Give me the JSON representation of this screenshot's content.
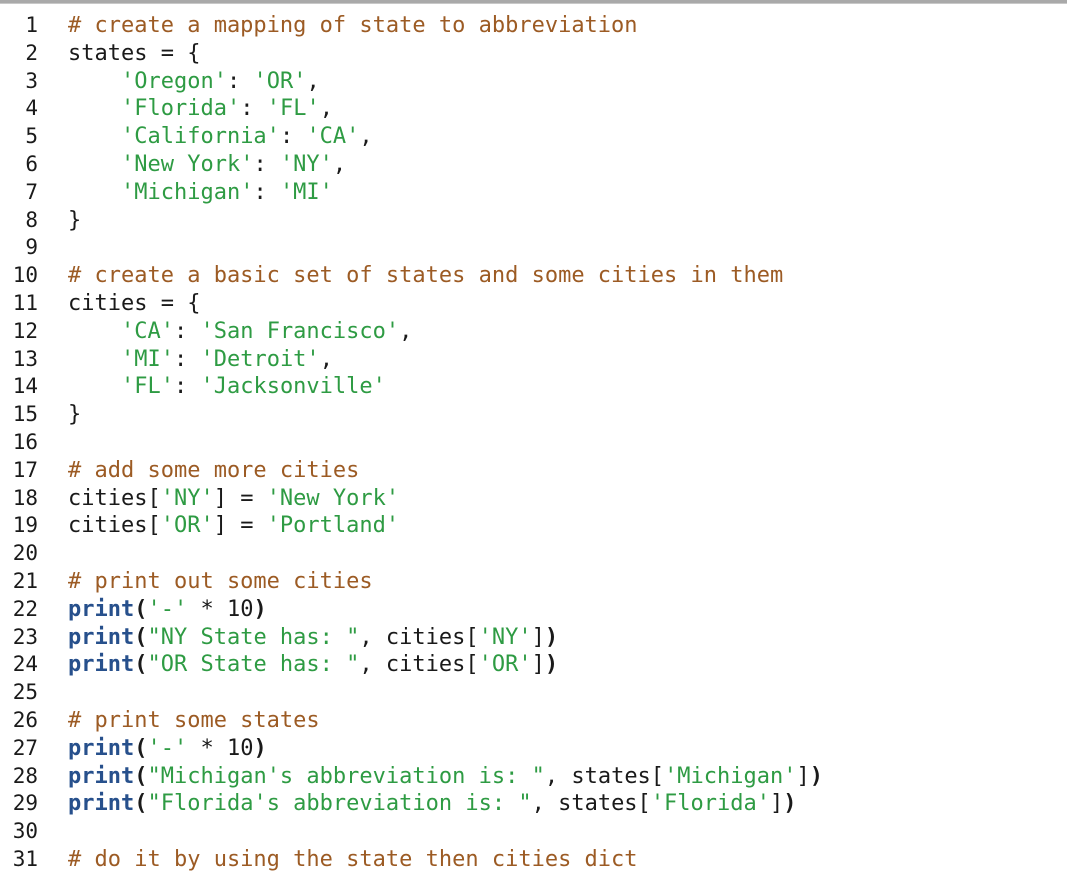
{
  "document": {
    "kind": "python-code-listing",
    "language": "Python",
    "first_line_number": 1,
    "last_line_number": 31,
    "total_lines_visible": 31
  },
  "theme": {
    "background": "#ffffff",
    "top_rule": "#a9a9a9",
    "line_number_color": "#1a1a1a",
    "comment_color": "#9c5b24",
    "string_color": "#2e9b43",
    "keyword_color": "#27508c",
    "punctuation_color": "#1a1a1a",
    "plain_color": "#1a1a1a"
  },
  "lines": [
    {
      "num": "1",
      "tokens": [
        {
          "t": "comment",
          "s": "# create a mapping of state to abbreviation"
        }
      ]
    },
    {
      "num": "2",
      "tokens": [
        {
          "t": "plain",
          "s": "states = {"
        }
      ]
    },
    {
      "num": "3",
      "tokens": [
        {
          "t": "plain",
          "s": "    "
        },
        {
          "t": "string",
          "s": "'Oregon'"
        },
        {
          "t": "plain",
          "s": ": "
        },
        {
          "t": "string",
          "s": "'OR'"
        },
        {
          "t": "plain",
          "s": ","
        }
      ]
    },
    {
      "num": "4",
      "tokens": [
        {
          "t": "plain",
          "s": "    "
        },
        {
          "t": "string",
          "s": "'Florida'"
        },
        {
          "t": "plain",
          "s": ": "
        },
        {
          "t": "string",
          "s": "'FL'"
        },
        {
          "t": "plain",
          "s": ","
        }
      ]
    },
    {
      "num": "5",
      "tokens": [
        {
          "t": "plain",
          "s": "    "
        },
        {
          "t": "string",
          "s": "'California'"
        },
        {
          "t": "plain",
          "s": ": "
        },
        {
          "t": "string",
          "s": "'CA'"
        },
        {
          "t": "plain",
          "s": ","
        }
      ]
    },
    {
      "num": "6",
      "tokens": [
        {
          "t": "plain",
          "s": "    "
        },
        {
          "t": "string",
          "s": "'New York'"
        },
        {
          "t": "plain",
          "s": ": "
        },
        {
          "t": "string",
          "s": "'NY'"
        },
        {
          "t": "plain",
          "s": ","
        }
      ]
    },
    {
      "num": "7",
      "tokens": [
        {
          "t": "plain",
          "s": "    "
        },
        {
          "t": "string",
          "s": "'Michigan'"
        },
        {
          "t": "plain",
          "s": ": "
        },
        {
          "t": "string",
          "s": "'MI'"
        }
      ]
    },
    {
      "num": "8",
      "tokens": [
        {
          "t": "plain",
          "s": "}"
        }
      ]
    },
    {
      "num": "9",
      "tokens": []
    },
    {
      "num": "10",
      "tokens": [
        {
          "t": "comment",
          "s": "# create a basic set of states and some cities in them"
        }
      ]
    },
    {
      "num": "11",
      "tokens": [
        {
          "t": "plain",
          "s": "cities = {"
        }
      ]
    },
    {
      "num": "12",
      "tokens": [
        {
          "t": "plain",
          "s": "    "
        },
        {
          "t": "string",
          "s": "'CA'"
        },
        {
          "t": "plain",
          "s": ": "
        },
        {
          "t": "string",
          "s": "'San Francisco'"
        },
        {
          "t": "plain",
          "s": ","
        }
      ]
    },
    {
      "num": "13",
      "tokens": [
        {
          "t": "plain",
          "s": "    "
        },
        {
          "t": "string",
          "s": "'MI'"
        },
        {
          "t": "plain",
          "s": ": "
        },
        {
          "t": "string",
          "s": "'Detroit'"
        },
        {
          "t": "plain",
          "s": ","
        }
      ]
    },
    {
      "num": "14",
      "tokens": [
        {
          "t": "plain",
          "s": "    "
        },
        {
          "t": "string",
          "s": "'FL'"
        },
        {
          "t": "plain",
          "s": ": "
        },
        {
          "t": "string",
          "s": "'Jacksonville'"
        }
      ]
    },
    {
      "num": "15",
      "tokens": [
        {
          "t": "plain",
          "s": "}"
        }
      ]
    },
    {
      "num": "16",
      "tokens": []
    },
    {
      "num": "17",
      "tokens": [
        {
          "t": "comment",
          "s": "# add some more cities"
        }
      ]
    },
    {
      "num": "18",
      "tokens": [
        {
          "t": "plain",
          "s": "cities["
        },
        {
          "t": "string",
          "s": "'NY'"
        },
        {
          "t": "plain",
          "s": "] = "
        },
        {
          "t": "string",
          "s": "'New York'"
        }
      ]
    },
    {
      "num": "19",
      "tokens": [
        {
          "t": "plain",
          "s": "cities["
        },
        {
          "t": "string",
          "s": "'OR'"
        },
        {
          "t": "plain",
          "s": "] = "
        },
        {
          "t": "string",
          "s": "'Portland'"
        }
      ]
    },
    {
      "num": "20",
      "tokens": []
    },
    {
      "num": "21",
      "tokens": [
        {
          "t": "comment",
          "s": "# print out some cities"
        }
      ]
    },
    {
      "num": "22",
      "tokens": [
        {
          "t": "keyword",
          "s": "print"
        },
        {
          "t": "punct",
          "s": "("
        },
        {
          "t": "string",
          "s": "'-'"
        },
        {
          "t": "plain",
          "s": " * "
        },
        {
          "t": "number",
          "s": "10"
        },
        {
          "t": "punct",
          "s": ")"
        }
      ]
    },
    {
      "num": "23",
      "tokens": [
        {
          "t": "keyword",
          "s": "print"
        },
        {
          "t": "punct",
          "s": "("
        },
        {
          "t": "string",
          "s": "\"NY State has: \""
        },
        {
          "t": "plain",
          "s": ", cities["
        },
        {
          "t": "string",
          "s": "'NY'"
        },
        {
          "t": "plain",
          "s": "]"
        },
        {
          "t": "punct",
          "s": ")"
        }
      ]
    },
    {
      "num": "24",
      "tokens": [
        {
          "t": "keyword",
          "s": "print"
        },
        {
          "t": "punct",
          "s": "("
        },
        {
          "t": "string",
          "s": "\"OR State has: \""
        },
        {
          "t": "plain",
          "s": ", cities["
        },
        {
          "t": "string",
          "s": "'OR'"
        },
        {
          "t": "plain",
          "s": "]"
        },
        {
          "t": "punct",
          "s": ")"
        }
      ]
    },
    {
      "num": "25",
      "tokens": []
    },
    {
      "num": "26",
      "tokens": [
        {
          "t": "comment",
          "s": "# print some states"
        }
      ]
    },
    {
      "num": "27",
      "tokens": [
        {
          "t": "keyword",
          "s": "print"
        },
        {
          "t": "punct",
          "s": "("
        },
        {
          "t": "string",
          "s": "'-'"
        },
        {
          "t": "plain",
          "s": " * "
        },
        {
          "t": "number",
          "s": "10"
        },
        {
          "t": "punct",
          "s": ")"
        }
      ]
    },
    {
      "num": "28",
      "tokens": [
        {
          "t": "keyword",
          "s": "print"
        },
        {
          "t": "punct",
          "s": "("
        },
        {
          "t": "string",
          "s": "\"Michigan's abbreviation is: \""
        },
        {
          "t": "plain",
          "s": ", states["
        },
        {
          "t": "string",
          "s": "'Michigan'"
        },
        {
          "t": "plain",
          "s": "]"
        },
        {
          "t": "punct",
          "s": ")"
        }
      ]
    },
    {
      "num": "29",
      "tokens": [
        {
          "t": "keyword",
          "s": "print"
        },
        {
          "t": "punct",
          "s": "("
        },
        {
          "t": "string",
          "s": "\"Florida's abbreviation is: \""
        },
        {
          "t": "plain",
          "s": ", states["
        },
        {
          "t": "string",
          "s": "'Florida'"
        },
        {
          "t": "plain",
          "s": "]"
        },
        {
          "t": "punct",
          "s": ")"
        }
      ]
    },
    {
      "num": "30",
      "tokens": []
    },
    {
      "num": "31",
      "tokens": [
        {
          "t": "comment",
          "s": "# do it by using the state then cities dict"
        }
      ]
    }
  ]
}
